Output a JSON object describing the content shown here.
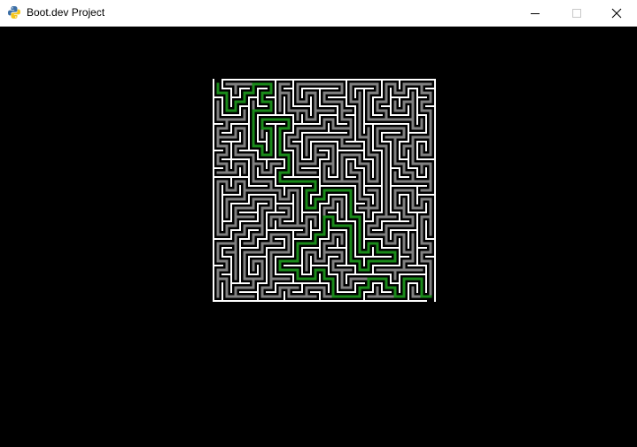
{
  "window": {
    "title": "Boot.dev Project",
    "app_icon": "python-icon",
    "controls": [
      "minimize-icon",
      "maximize-icon",
      "close-icon"
    ]
  },
  "canvas": {
    "background": "#000000"
  },
  "maze": {
    "rows": 25,
    "cols": 25,
    "colors": {
      "wall": "#ffffff",
      "visited_path": "#808080",
      "solution_path": "#1a8a1a"
    }
  }
}
